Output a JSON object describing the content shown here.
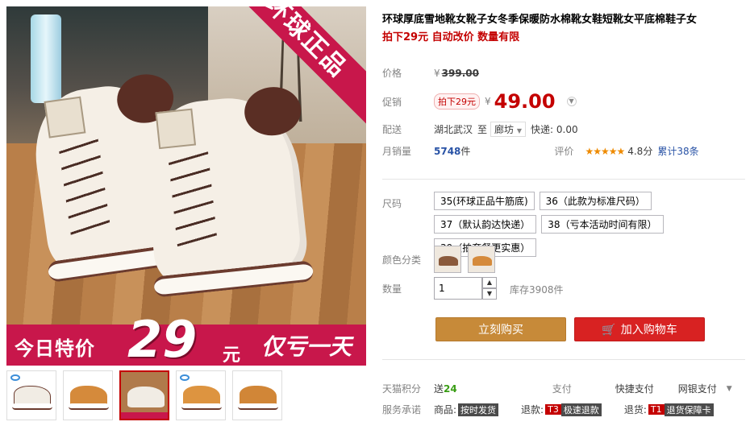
{
  "product": {
    "title": "环球厚底雪地靴女靴子女冬季保暖防水棉靴女鞋短靴女平底棉鞋子女",
    "subtitle": "拍下29元 自动改价 数量有限"
  },
  "main_image": {
    "corner_text": "环球正品",
    "promo_text_1": "今日特价",
    "promo_price": "29",
    "promo_unit": "元",
    "promo_text_2": "仅亏一天"
  },
  "price": {
    "label": "价格",
    "currency": "¥",
    "original": "399.00"
  },
  "promo": {
    "label": "促销",
    "badge": "拍下29元",
    "currency": "¥",
    "price": "49.00"
  },
  "delivery": {
    "label": "配送",
    "from": "湖北武汉",
    "to_label": "至",
    "to": "廊坊",
    "shipping": "快递: 0.00"
  },
  "sales": {
    "label": "月销量",
    "count": "5748",
    "unit": "件",
    "rating_label": "评价",
    "stars": "★★★★★",
    "score": "4.8分",
    "review_link": "累计38条"
  },
  "size": {
    "label": "尺码",
    "options": [
      "35(环球正品牛筋底)",
      "36（此款为标准尺码）",
      "37（默认韵达快递）",
      "38（亏本活动时间有限）",
      "39（拍套餐更实惠）"
    ]
  },
  "color": {
    "label": "颜色分类",
    "swatches": [
      "#8a5a3c",
      "#d58a3b"
    ]
  },
  "quantity": {
    "label": "数量",
    "value": "1",
    "stock": "库存3908件",
    "up": "▲",
    "down": "▼"
  },
  "actions": {
    "buy_now": "立刻购买",
    "add_cart": "加入购物车"
  },
  "footer": {
    "points_label": "天猫积分",
    "points_prefix": "送",
    "points_value": "24",
    "pay_label": "支付",
    "pay_1": "快捷支付",
    "pay_2": "网银支付",
    "service_label": "服务承诺",
    "svc_1_label": "商品:",
    "svc_1_tag": "按时发货",
    "svc_2_label": "退款:",
    "svc_2_code": "T3",
    "svc_2_tag": "极速退款",
    "svc_3_label": "退货:",
    "svc_3_code": "T1",
    "svc_3_tag": "退货保障卡"
  },
  "colors": {
    "accent": "#c40000",
    "buy_button": "#c78a39",
    "cart_button": "#d82222",
    "promo_banner": "#c8174b"
  }
}
